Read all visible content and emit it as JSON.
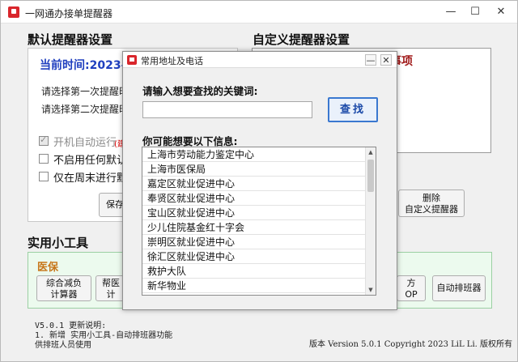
{
  "window": {
    "title": "一网通办接单提醒器",
    "minimize_label": "—",
    "maximize_label": "☐",
    "close_label": "✕"
  },
  "default_settings": {
    "heading": "默认提醒器设置",
    "current_time": "当前时间:2023-6-1",
    "first_reminder": "请选择第一次提醒时",
    "second_reminder": "请选择第二次提醒时",
    "options": [
      {
        "label": "开机自动运行",
        "checked": true,
        "disabled": true
      },
      {
        "label": "不启用任何默认提",
        "checked": false,
        "disabled": false
      },
      {
        "label": "仅在周末进行默认",
        "checked": false,
        "disabled": false
      }
    ],
    "option_extra": "(建",
    "save_button": "保存"
  },
  "custom_settings": {
    "heading": "自定义提醒器设置",
    "item_text": "事项",
    "delete_button": [
      "删除",
      "自定义提醒器"
    ]
  },
  "tools": {
    "heading": "实用小工具",
    "category": "医保",
    "buttons": [
      [
        "综合减负",
        "计算器"
      ],
      [
        "帮医",
        "计"
      ],
      [
        "方",
        "OP"
      ],
      [
        "自动排班器"
      ]
    ]
  },
  "release_notes": {
    "lines": [
      "V5.0.1 更新说明:",
      "1. 新增 实用小工具-自动排班器功能",
      "   供排班人员使用"
    ]
  },
  "version_text": "版本 Version 5.0.1  Copyright 2023 LiL Li. 版权所有",
  "dialog": {
    "title": "常用地址及电话",
    "minimize_label": "—",
    "close_label": "✕",
    "keyword_label": "请输入想要查找的关键词:",
    "search_value": "",
    "search_button": "查找",
    "results_label": "你可能想要以下信息:",
    "results": [
      "上海市劳动能力鉴定中心",
      "上海市医保局",
      "嘉定区就业促进中心",
      "奉贤区就业促进中心",
      "宝山区就业促进中心",
      "少儿住院基金红十字会",
      "崇明区就业促进中心",
      "徐汇区就业促进中心",
      "救护大队",
      "新华物业"
    ]
  }
}
